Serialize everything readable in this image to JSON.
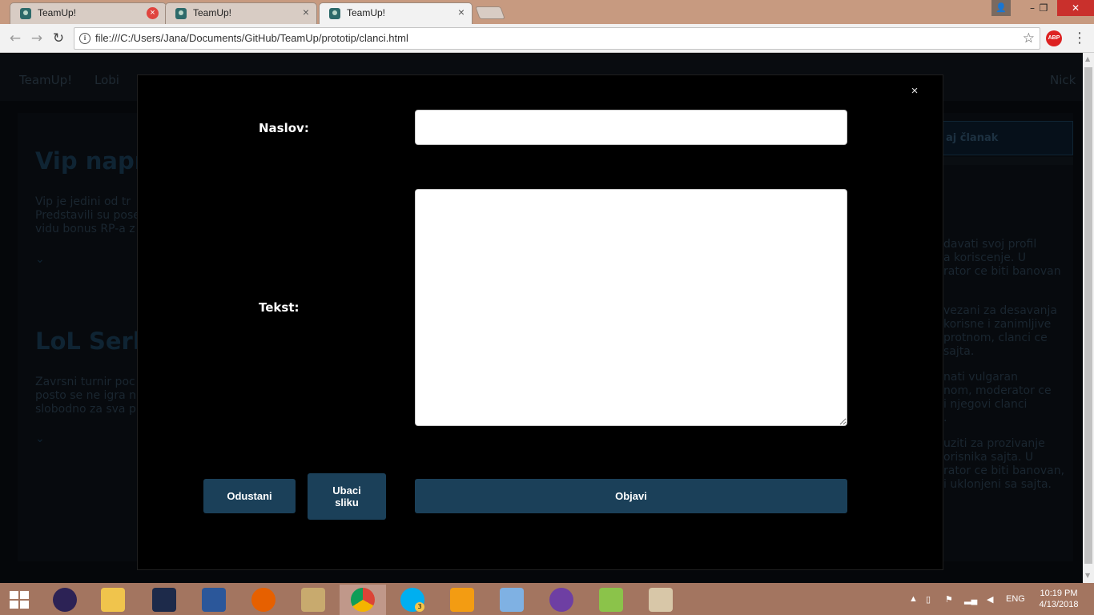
{
  "browser": {
    "tabs": [
      {
        "title": "TeamUp!",
        "close": "×"
      },
      {
        "title": "TeamUp!",
        "close": "×"
      },
      {
        "title": "TeamUp!",
        "close": "×"
      }
    ],
    "url": "file:///C:/Users/Jana/Documents/GitHub/TeamUp/prototip/clanci.html",
    "info_glyph": "i",
    "abp_label": "ABP",
    "nav_glyphs": {
      "back": "←",
      "forward": "→",
      "reload": "↻"
    },
    "star_glyph": "☆",
    "window_glyphs": {
      "user": "👤",
      "minimize": "–",
      "restore": "❐",
      "close": "✕"
    }
  },
  "page": {
    "nav": {
      "brand": "TeamUp!",
      "lobby": "Lobi",
      "user": "Nick"
    },
    "add_article_label": "aj članak",
    "articles": [
      {
        "title": "Vip napra",
        "text": [
          "Vip je jedini od tr",
          "Predstavili su pose",
          "vidu bonus RP-a z"
        ]
      },
      {
        "title": "LoL Serb",
        "text": [
          "Zavrsni turnir poc",
          "posto se ne igra n",
          "slobodno za sva pi"
        ]
      }
    ],
    "chevron": "⌄",
    "rules_fragments": [
      " davati svoj profil",
      "a koriscenje. U",
      "rator ce biti banovan",
      " vezani za desavanja",
      "korisne i zanimljive",
      "protnom, clanci ce",
      "sajta.",
      "nati vulgaran",
      "nom, moderator ce",
      "i njegovi clanci",
      ".",
      "uziti za prozivanje",
      "orisnika sajta. U",
      "rator ce biti banovan,",
      "i uklonjeni sa sajta."
    ]
  },
  "modal": {
    "close_glyph": "×",
    "title_label": "Naslov:",
    "title_value": "",
    "text_label": "Tekst:",
    "text_value": "",
    "cancel_label": "Odustani",
    "insert_image_label": "Ubaci sliku",
    "publish_label": "Objavi"
  },
  "taskbar": {
    "apps": [
      "eclipse-icon",
      "file-explorer-icon",
      "game-icon",
      "word-icon",
      "firefox-icon",
      "league-of-legends-icon",
      "chrome-icon",
      "skype-icon",
      "video-icon",
      "virtualbox-icon",
      "github-icon",
      "notepad-plus-plus-icon",
      "paint-icon"
    ],
    "active_app": "chrome-icon",
    "language": "ENG",
    "time": "10:19 PM",
    "date": "4/13/2018",
    "skype_badge": "3"
  },
  "colors": {
    "titlebar": "#c79a80",
    "taskbar": "#a37560",
    "button": "#1b4059",
    "modal_bg": "#000000"
  }
}
